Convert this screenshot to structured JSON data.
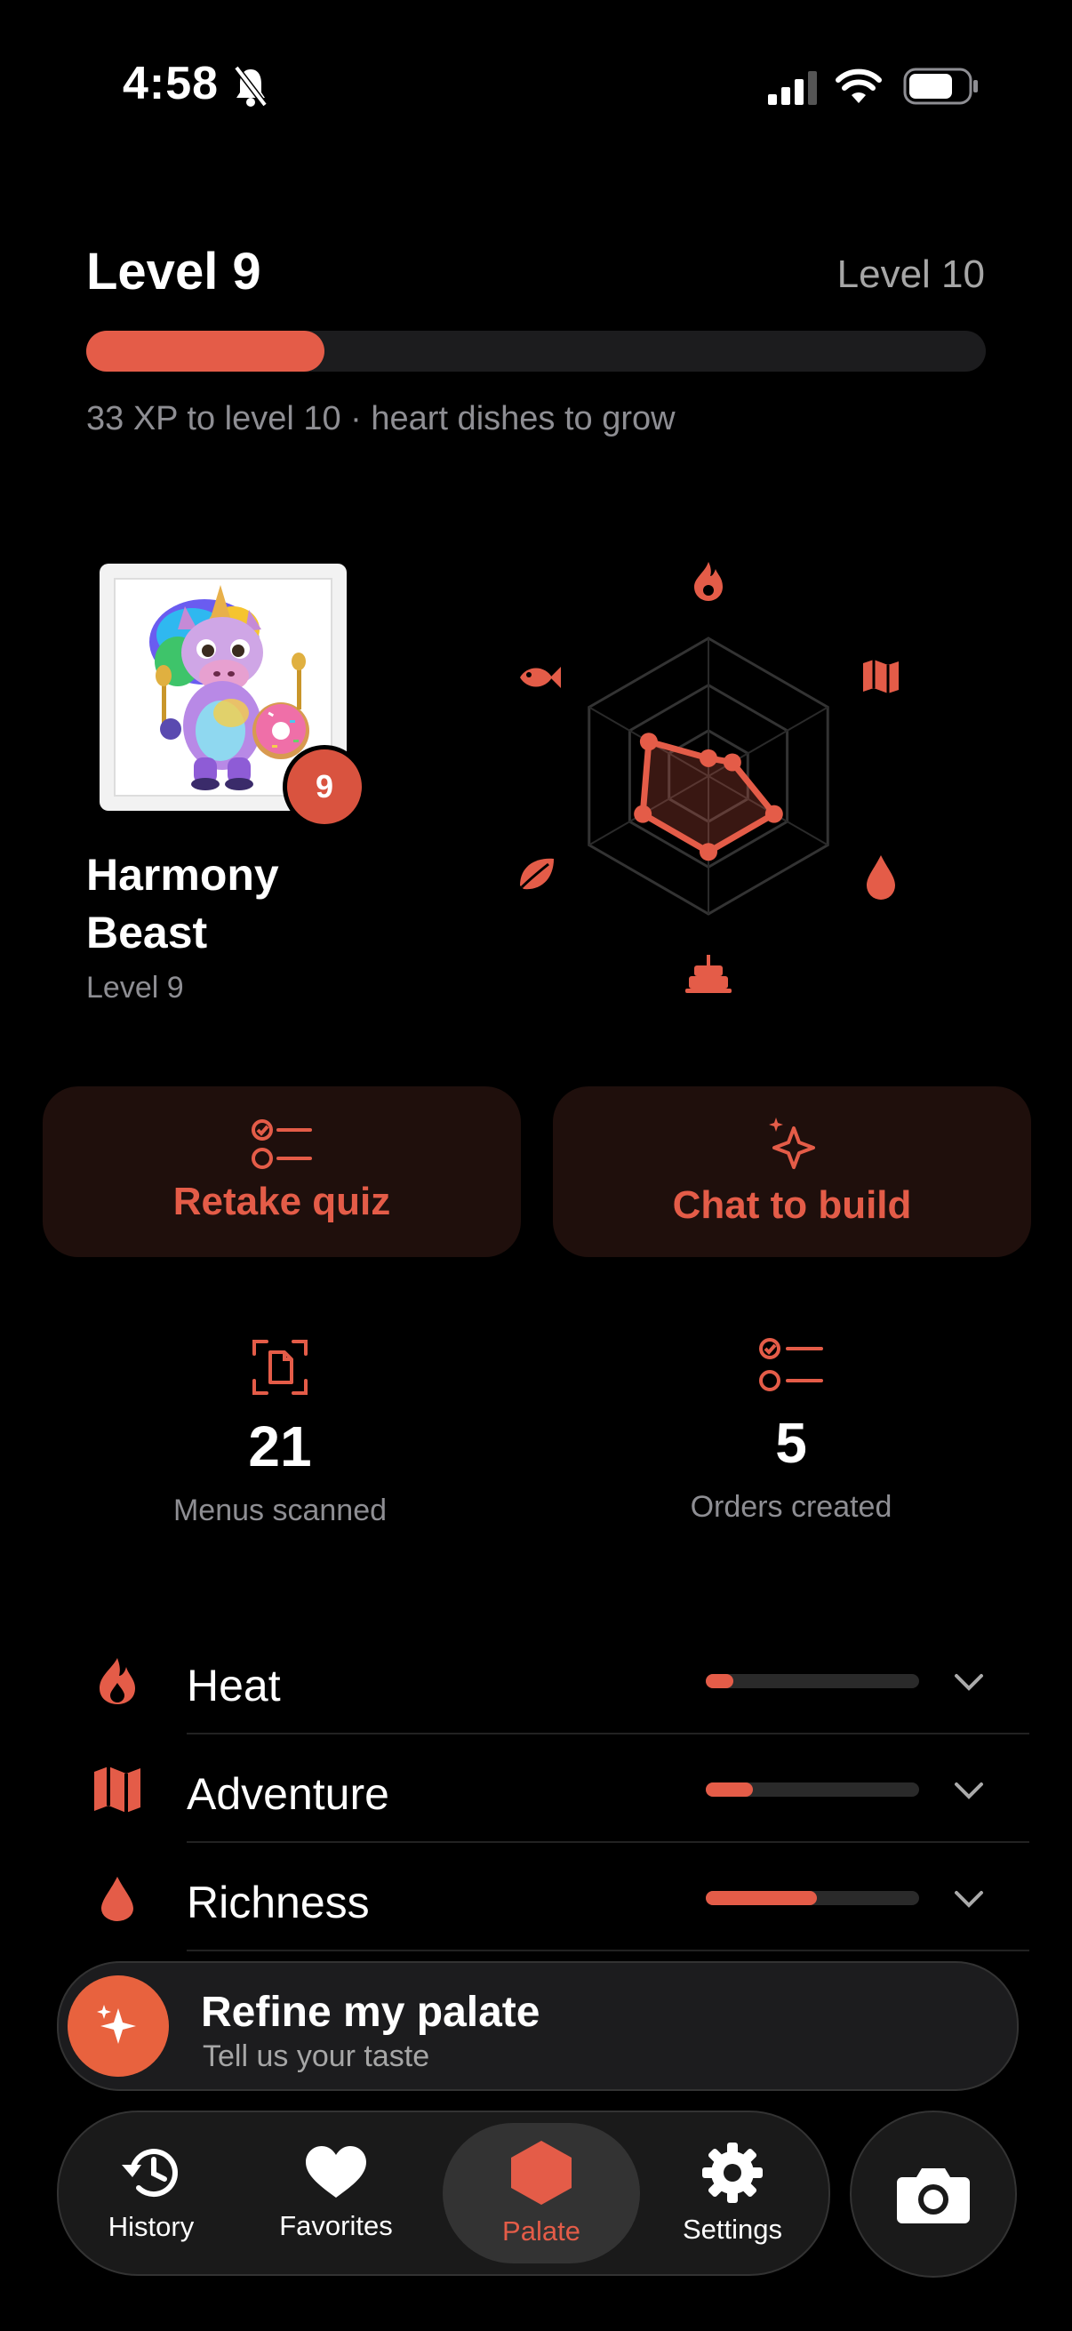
{
  "status_bar": {
    "time": "4:58"
  },
  "level": {
    "current_label": "Level 9",
    "next_label": "Level 10",
    "progress_fraction": 0.265,
    "caption": "33 XP to level 10 · heart dishes to grow"
  },
  "profile": {
    "name": "Harmony Beast",
    "level_text": "Level 9",
    "badge": "9"
  },
  "palate_radar": {
    "axes": [
      "heat-icon",
      "adventure-icon",
      "richness-icon",
      "sweetness-icon",
      "freshness-icon",
      "seafood-icon"
    ],
    "values": [
      0.13,
      0.2,
      0.55,
      0.55,
      0.55,
      0.5
    ]
  },
  "actions": {
    "retake_label": "Retake quiz",
    "chat_label": "Chat to build"
  },
  "stats": {
    "menus_value": "21",
    "menus_caption": "Menus scanned",
    "orders_value": "5",
    "orders_caption": "Orders created"
  },
  "traits": [
    {
      "name": "Heat",
      "level": 0.13
    },
    {
      "name": "Adventure",
      "level": 0.22
    },
    {
      "name": "Richness",
      "level": 0.52
    }
  ],
  "refine": {
    "title": "Refine my palate",
    "subtitle": "Tell us your taste"
  },
  "tabs": {
    "history": "History",
    "favorites": "Favorites",
    "palate": "Palate",
    "settings": "Settings"
  },
  "colors": {
    "accent": "#e45c48",
    "background": "#000000"
  }
}
